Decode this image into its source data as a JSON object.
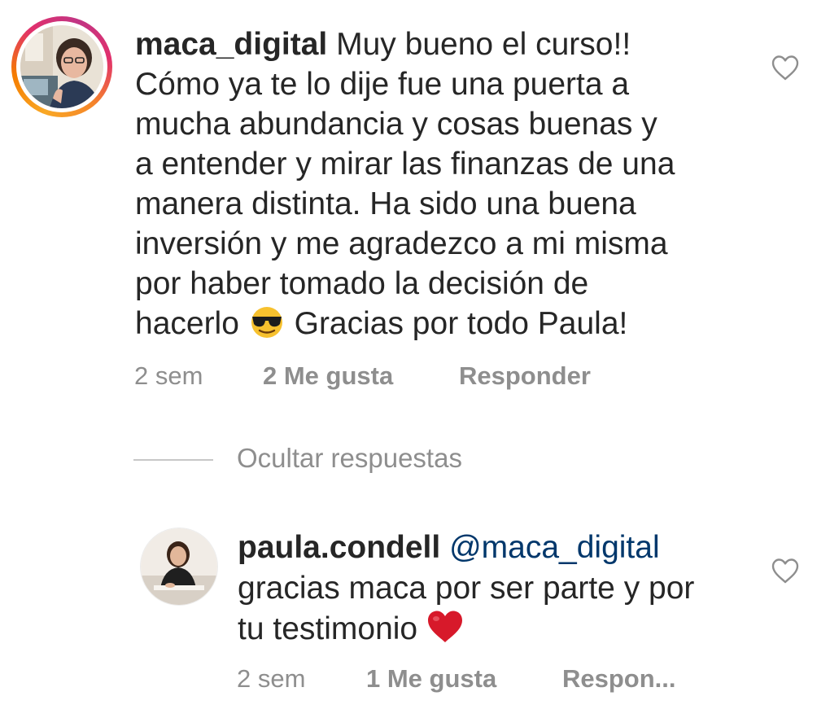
{
  "main_comment": {
    "username": "maca_digital",
    "lines": [
      "Muy bueno el curso!!",
      "Cómo ya te lo dije fue una puerta a",
      "mucha abundancia y cosas buenas y",
      "a entender y mirar las finanzas de una",
      "manera distinta. Ha sido una buena",
      "inversión y me agradezco a mi misma",
      "por haber tomado la decisión de",
      "hacerlo",
      "Gracias por todo Paula!"
    ],
    "emoji": "sunglasses-emoji",
    "time": "2 sem",
    "likes": "2 Me gusta",
    "reply_label": "Responder"
  },
  "hide_replies_label": "Ocultar respuestas",
  "reply_comment": {
    "username": "paula.condell",
    "mention": "@maca_digital",
    "lines": [
      "gracias maca por ser parte y por",
      "tu testimonio"
    ],
    "emoji": "red-heart-emoji",
    "time": "2 sem",
    "likes": "1 Me gusta",
    "reply_label": "Respon..."
  },
  "icons": {
    "like": "heart-outline-icon"
  },
  "colors": {
    "text": "#262626",
    "secondary": "#8e8e8e",
    "mention": "#00376b",
    "heart_emoji": "#d7192a"
  }
}
